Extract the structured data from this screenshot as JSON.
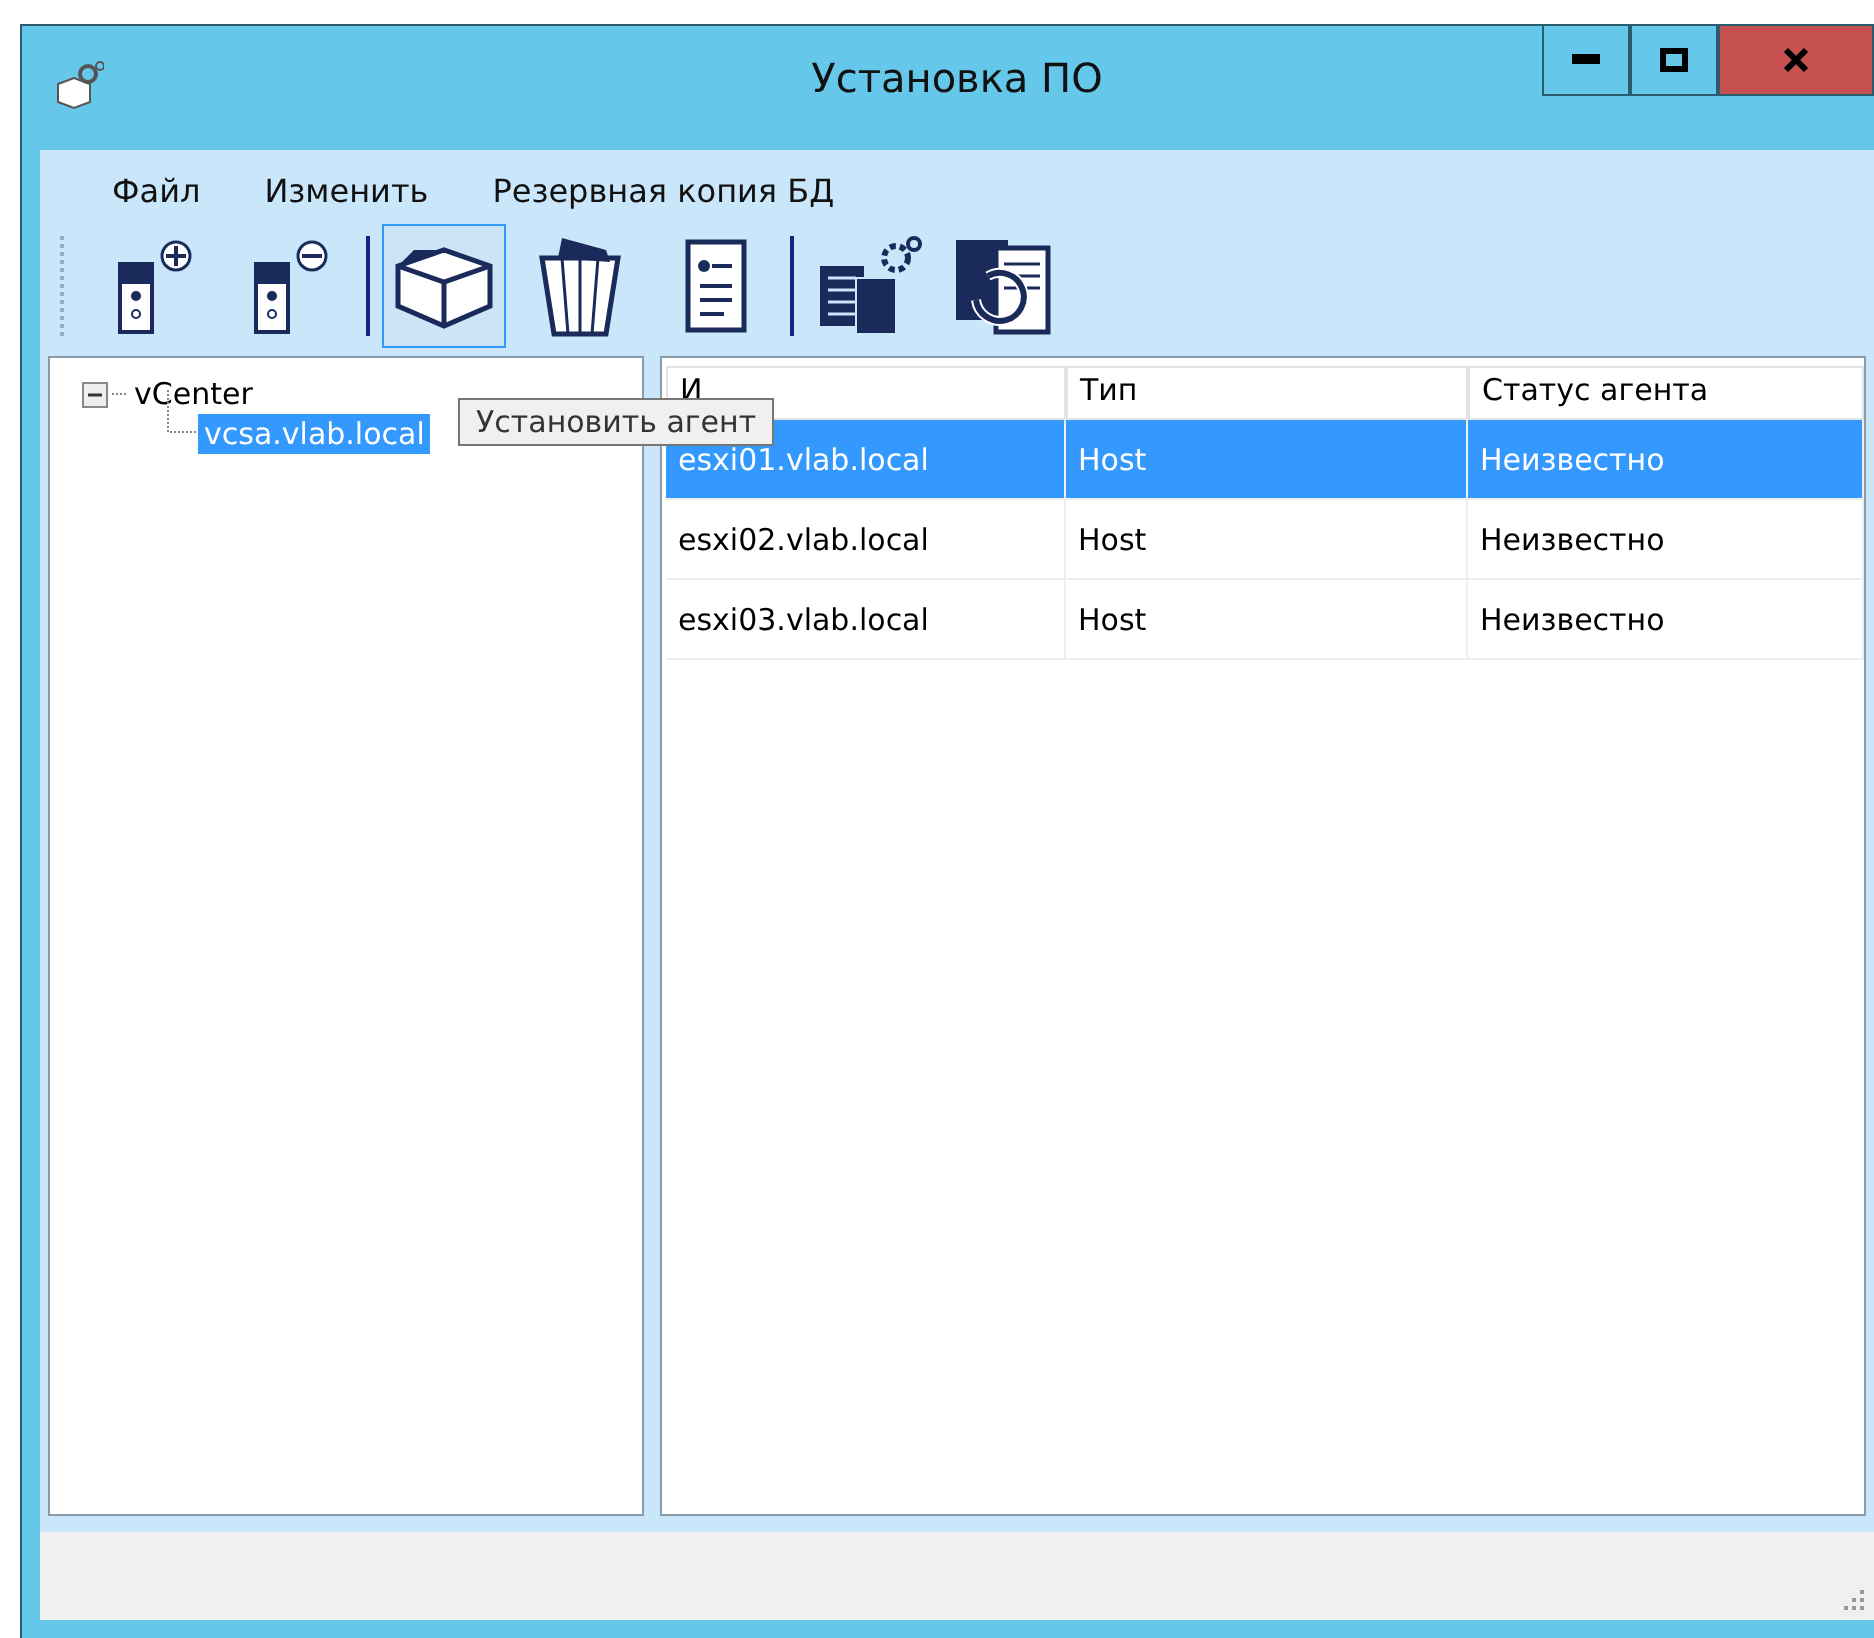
{
  "window": {
    "title": "Установка ПО"
  },
  "menu": [
    "Файл",
    "Изменить",
    "Резервная копия БД"
  ],
  "toolbar": [
    {
      "kind": "add-server",
      "selected": false
    },
    {
      "kind": "remove-server",
      "selected": false
    },
    {
      "kind": "separator"
    },
    {
      "kind": "box",
      "selected": true
    },
    {
      "kind": "trash",
      "selected": false
    },
    {
      "kind": "document",
      "selected": false
    },
    {
      "kind": "separator"
    },
    {
      "kind": "books-gear",
      "selected": false
    },
    {
      "kind": "books-refresh",
      "selected": false
    }
  ],
  "tooltip": "Установить агент",
  "tree": [
    {
      "label": "vCenter",
      "expanded": true,
      "selected": false,
      "children": [
        {
          "label": "vcsa.vlab.local",
          "selected": true
        }
      ]
    }
  ],
  "table": {
    "columns": [
      "И",
      "Тип",
      "Статус агента"
    ],
    "rows": [
      {
        "cells": [
          "esxi01.vlab.local",
          "Host",
          "Неизвестно"
        ],
        "selected": true
      },
      {
        "cells": [
          "esxi02.vlab.local",
          "Host",
          "Неизвестно"
        ],
        "selected": false
      },
      {
        "cells": [
          "esxi03.vlab.local",
          "Host",
          "Неизвестно"
        ],
        "selected": false
      }
    ]
  }
}
